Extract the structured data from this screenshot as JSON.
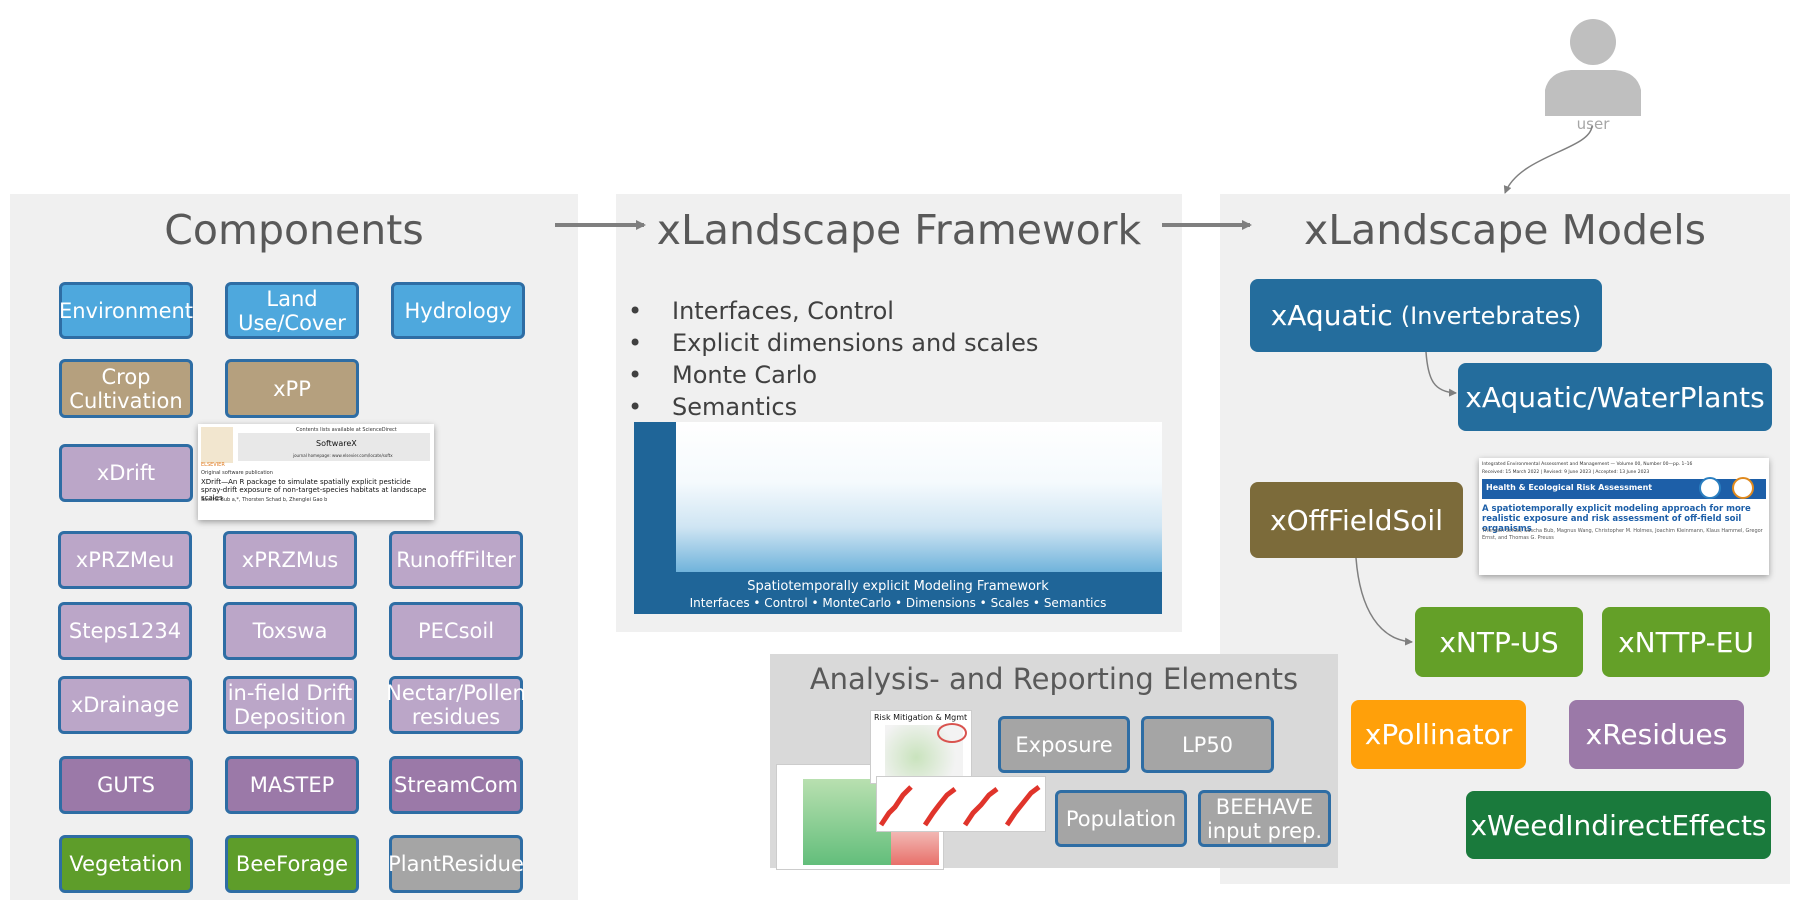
{
  "user": {
    "label": "user"
  },
  "components": {
    "title": "Components",
    "items": [
      {
        "label": "Environment"
      },
      {
        "label": "Land\nUse/Cover"
      },
      {
        "label": "Hydrology"
      },
      {
        "label": "Crop\nCultivation"
      },
      {
        "label": "xPP"
      },
      {
        "label": "xDrift"
      },
      {
        "label": "xPRZMeu"
      },
      {
        "label": "xPRZMus"
      },
      {
        "label": "RunoffFilter"
      },
      {
        "label": "Steps1234"
      },
      {
        "label": "Toxswa"
      },
      {
        "label": "PECsoil"
      },
      {
        "label": "xDrainage"
      },
      {
        "label": "in-field Drift\nDeposition"
      },
      {
        "label": "Nectar/Pollen\nresidues"
      },
      {
        "label": "GUTS"
      },
      {
        "label": "MASTEP"
      },
      {
        "label": "StreamCom"
      },
      {
        "label": "Vegetation"
      },
      {
        "label": "BeeForage"
      },
      {
        "label": "PlantResidue"
      }
    ],
    "paper": {
      "journal": "SoftwareX",
      "header": "Contents lists available at ScienceDirect",
      "homepage": "journal homepage: www.elsevier.com/locate/softx",
      "publisher": "ELSEVIER",
      "type": "Original software publication",
      "title": "XDrift—An R package to simulate spatially explicit pesticide spray-drift exposure of non-target-species habitats at landscape scales",
      "authors": "Sascha Bub a,*, Thorsten Schad b, Zhenglei Gao b"
    }
  },
  "framework": {
    "title": "xLandscape Framework",
    "bullets": [
      "Interfaces, Control",
      "Explicit dimensions and scales",
      "Monte Carlo",
      "Semantics"
    ],
    "banner_line1": "Spatiotemporally explicit Modeling Framework",
    "banner_line2": "Interfaces • Control • MonteCarlo • Dimensions • Scales • Semantics"
  },
  "analysis": {
    "title": "Analysis- and Reporting Elements",
    "thumb_label": "Risk Mitigation & Mgmt",
    "items": [
      {
        "label": "Exposure"
      },
      {
        "label": "LP50"
      },
      {
        "label": "Population"
      },
      {
        "label": "BEEHAVE\ninput prep."
      }
    ]
  },
  "models": {
    "title": "xLandscape Models",
    "aquatic": "xAquatic",
    "aquatic_sub": "(Invertebrates)",
    "waterplants": "xAquatic/WaterPlants",
    "offfield": "xOffFieldSoil",
    "ntp_us": "xNTP-US",
    "nttp_eu": "xNTTP-EU",
    "pollinator": "xPollinator",
    "residues": "xResidues",
    "weed": "xWeedIndirectEffects",
    "paper": {
      "journal": "Integrated Environmental Assessment and Management — Volume 00, Number 00—pp. 1–16",
      "dates": "Received: 15 March 2022 | Revised: 9 June 2023 | Accepted: 13 June 2023",
      "section": "Health & Ecological Risk Assessment",
      "title": "A spatiotemporally explicit modeling approach for more realistic exposure and risk assessment of off-field soil organisms",
      "authors": "Thorsten Schad, Sascha Bub, Magnus Wang, Christopher M. Holmes, Joachim Kleinmann, Klaus Hammel, Gregor Ernst, and Thomas G. Preuss"
    }
  }
}
